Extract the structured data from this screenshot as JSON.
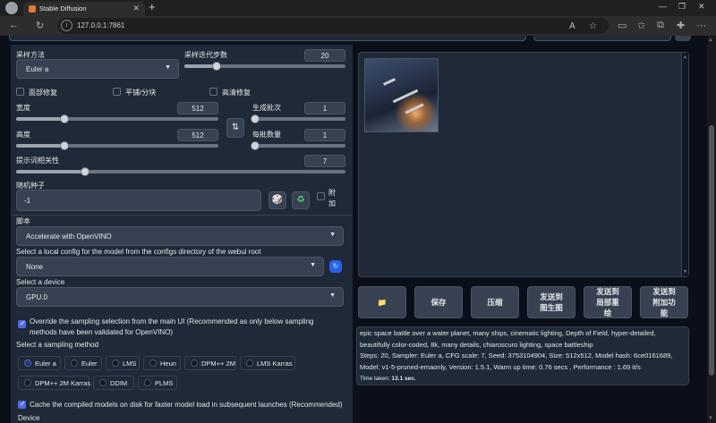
{
  "browser": {
    "tab_title": "Stable Diffusion",
    "url": "127.0.0.1:7861",
    "new_tab_label": "+",
    "close_tab_label": "✕"
  },
  "left": {
    "sampler_label": "采样方法",
    "sampler_value": "Euler a",
    "steps_label": "采样迭代步数",
    "steps_value": "20",
    "steps_fraction": 0.2,
    "checkboxes": [
      {
        "label": "面部修复",
        "checked": false
      },
      {
        "label": "平铺/分块",
        "checked": false
      },
      {
        "label": "高清修复",
        "checked": false
      }
    ],
    "width_label": "宽度",
    "width_value": "512",
    "width_fraction": 0.25,
    "height_label": "高度",
    "height_value": "512",
    "height_fraction": 0.25,
    "batch_count_label": "生成批次",
    "batch_count_value": "1",
    "batch_size_label": "每批数量",
    "batch_size_value": "1",
    "swap_icon": "swap-icon",
    "cfg_label": "提示词相关性",
    "cfg_value": "7",
    "cfg_fraction": 0.2,
    "seed_label": "随机种子",
    "seed_value": "-1",
    "extra_label": "附加",
    "script_label": "脚本",
    "script_value": "Accelerate with OpenVINO",
    "config_label": "Select a local config for the model from the configs directory of the webui root",
    "config_value": "None",
    "device_label": "Select a device",
    "device_value": "GPU.0",
    "override_label": "Override the sampling selection from the main UI (Recommended as only below sampling methods have been validated for OpenVINO)",
    "override_checked": true,
    "sampling_method_label": "Select a sampling method",
    "sampling_methods": [
      "Euler a",
      "Euler",
      "LMS",
      "Heun",
      "DPM++ 2M",
      "LMS Karras",
      "DPM++ 2M Karras",
      "DDIM",
      "PLMS"
    ],
    "sampling_selected": "Euler a",
    "cache_label": "Cache the compiled models on disk for faster model load in subsequent launches (Recommended)",
    "cache_checked": true,
    "device_footer_label": "Device"
  },
  "right": {
    "buttons": [
      {
        "label": "📁",
        "icon": "folder-icon"
      },
      {
        "label": "保存"
      },
      {
        "label": "压缩"
      },
      {
        "label": "发送到图生图"
      },
      {
        "label": "发送到局部重绘"
      },
      {
        "label": "发送到附加功能"
      }
    ],
    "info_line1": "epic space battle over a water planet, many ships, cinematic lighting, Depth of Field, hyper-detailed, beautifully color-coded, 8k, many details, chiaroscuro lighting, space battleship",
    "info_line2": "Steps: 20, Sampler: Euler a, CFG scale: 7, Seed: 3753104904, Size: 512x512, Model hash: 6ce0161689, Model: v1-5-pruned-emaonly, Version: 1.5.1, Warm up time: 0.76 secs , Performance : 1.69 it/s",
    "time_label": "Time taken:",
    "time_value": "13.1 sec."
  },
  "colors": {
    "accent": "#4f6be6",
    "panel": "#1f2937",
    "background": "#0b0f19"
  }
}
